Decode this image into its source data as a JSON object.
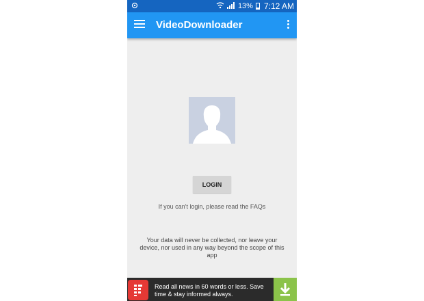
{
  "statusbar": {
    "battery": "13%",
    "time": "7:12 AM"
  },
  "appbar": {
    "title": "VideoDownloader"
  },
  "main": {
    "login_label": "LOGIN",
    "faq_text": "If you can't login, please read the FAQs",
    "privacy_text": "Your data will never be collected, nor leave your device, nor used in any way beyond the scope of this app"
  },
  "ad": {
    "text": "Read all news in 60 words or less. Save time & stay informed always."
  },
  "colors": {
    "statusbar": "#1565c0",
    "appbar": "#2196f3",
    "background": "#eeeeee",
    "ad_download": "#8bc34a",
    "ad_logo": "#e53935"
  }
}
